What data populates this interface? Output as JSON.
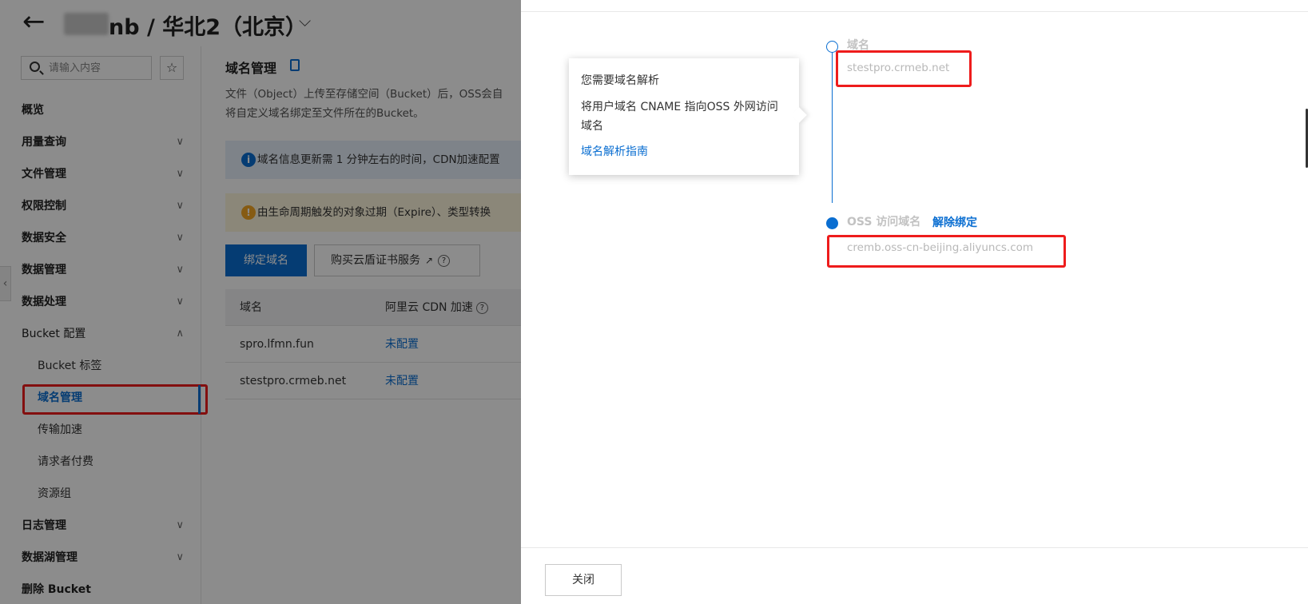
{
  "header": {
    "back_icon": "arrow-left-icon",
    "region_title": "nb / 华北2（北京）"
  },
  "sidebar": {
    "search_placeholder": "请输入内容",
    "items": [
      {
        "label": "概览"
      },
      {
        "label": "用量查询"
      },
      {
        "label": "文件管理"
      },
      {
        "label": "权限控制"
      },
      {
        "label": "数据安全"
      },
      {
        "label": "数据管理"
      },
      {
        "label": "数据处理"
      },
      {
        "label": "Bucket 配置"
      },
      {
        "label": "Bucket 标签"
      },
      {
        "label": "域名管理"
      },
      {
        "label": "传输加速"
      },
      {
        "label": "请求者付费"
      },
      {
        "label": "资源组"
      },
      {
        "label": "日志管理"
      },
      {
        "label": "数据湖管理"
      },
      {
        "label": "删除 Bucket"
      }
    ],
    "active_item": "域名管理"
  },
  "main": {
    "title": "域名管理",
    "description_line1": "文件（Object）上传至存储空间（Bucket）后，OSS会自",
    "description_line2": "将自定义域名绑定至文件所在的Bucket。",
    "alert_info": "域名信息更新需 1 分钟左右的时间，CDN加速配置",
    "alert_warn": "由生命周期触发的对象过期（Expire）、类型转换",
    "bind_button": "绑定域名",
    "buy_cert_button": "购买云盾证书服务",
    "table": {
      "headers": [
        "域名",
        "阿里云 CDN 加速"
      ],
      "rows": [
        {
          "domain": "spro.lfmn.fun",
          "cdn": "未配置"
        },
        {
          "domain": "stestpro.crmeb.net",
          "cdn": "未配置"
        }
      ]
    }
  },
  "drawer": {
    "tooltip": {
      "title": "您需要域名解析",
      "body": "将用户域名 CNAME 指向OSS 外网访问域名",
      "link": "域名解析指南"
    },
    "step1_label": "域名",
    "step1_value": "stestpro.crmeb.net",
    "step2_label": "OSS 访问域名",
    "unbind_link": "解除绑定",
    "step2_value": "cremb.oss-cn-beijing.aliyuncs.com",
    "close_button": "关闭"
  },
  "colors": {
    "accent": "#0a6ed1",
    "highlight": "#ee1c1c",
    "info_bg": "#e6eef9",
    "warn_bg": "#fdf6dd"
  }
}
